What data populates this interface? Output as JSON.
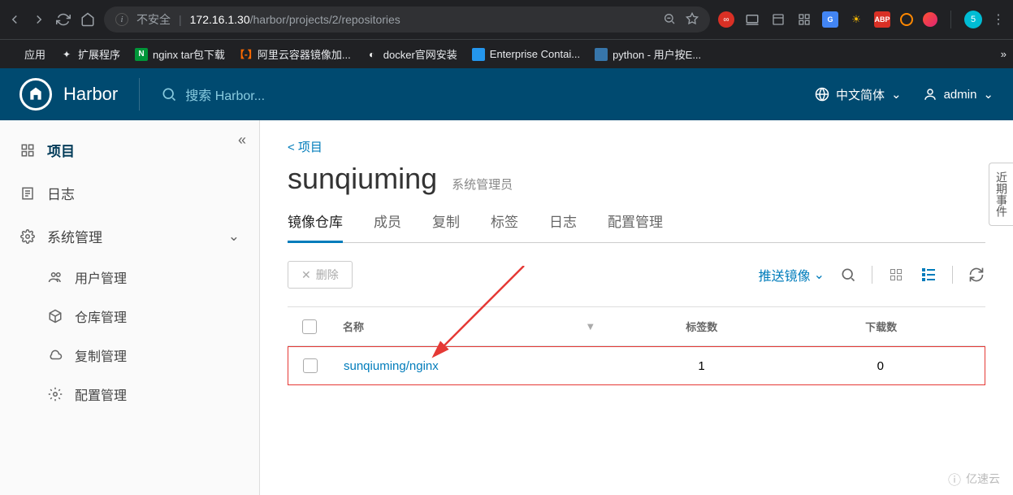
{
  "browser": {
    "insecure": "不安全",
    "url_host": "172.16.1.30",
    "url_path": "/harbor/projects/2/repositories",
    "avatar": "5"
  },
  "bookmarks": {
    "apps": "应用",
    "ext": "扩展程序",
    "nginx": "nginx tar包下载",
    "aliyun": "阿里云容器镜像加...",
    "docker": "docker官网安装",
    "enterprise": "Enterprise Contai...",
    "python": "python - 用户按E..."
  },
  "harbor": {
    "brand": "Harbor",
    "search_placeholder": "搜索 Harbor...",
    "lang": "中文简体",
    "user": "admin"
  },
  "sidebar": {
    "projects": "项目",
    "logs": "日志",
    "admin": "系统管理",
    "users": "用户管理",
    "repos": "仓库管理",
    "replication": "复制管理",
    "config": "配置管理"
  },
  "content": {
    "back": "< 项目",
    "title": "sunqiuming",
    "role": "系统管理员",
    "tabs": {
      "repos": "镜像仓库",
      "members": "成员",
      "replication": "复制",
      "labels": "标签",
      "logs": "日志",
      "config": "配置管理"
    },
    "delete": "删除",
    "push": "推送镜像",
    "columns": {
      "name": "名称",
      "tags": "标签数",
      "downloads": "下载数"
    },
    "rows": [
      {
        "name": "sunqiuming/nginx",
        "tags": "1",
        "downloads": "0"
      }
    ],
    "side_tab": "近期事件",
    "watermark": "亿速云"
  }
}
